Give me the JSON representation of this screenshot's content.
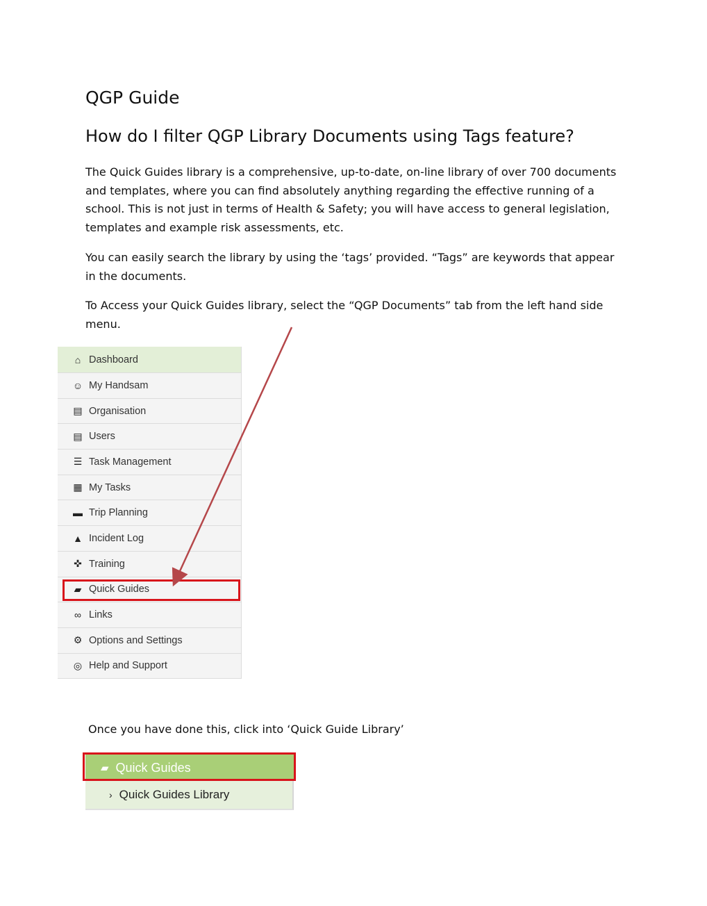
{
  "title": "QGP Guide",
  "heading": "How do I filter QGP Library Documents using Tags feature?",
  "paragraphs": {
    "p1": "The Quick Guides library is a comprehensive, up-to-date, on-line library of over 700 documents and templates, where you can find absolutely anything regarding the effective running of a school. This is not just in terms of Health & Safety; you will have access to general legislation, templates and example risk assessments, etc.",
    "p2": "You can easily search the library by using the ‘tags’ provided. “Tags” are keywords that appear in the documents.",
    "p3": "To Access your Quick Guides library, select the “QGP Documents” tab from  the left hand side menu.",
    "p4": "Once you have done this, click into ‘Quick Guide Library’"
  },
  "menu": {
    "items": [
      {
        "label": "Dashboard",
        "icon": "home-icon",
        "glyph": "⌂"
      },
      {
        "label": "My Handsam",
        "icon": "user-icon",
        "glyph": "☺"
      },
      {
        "label": "Organisation",
        "icon": "briefcase-icon",
        "glyph": "▤"
      },
      {
        "label": "Users",
        "icon": "briefcase-icon",
        "glyph": "▤"
      },
      {
        "label": "Task Management",
        "icon": "list-icon",
        "glyph": "☰"
      },
      {
        "label": "My Tasks",
        "icon": "table-icon",
        "glyph": "▦"
      },
      {
        "label": "Trip Planning",
        "icon": "car-icon",
        "glyph": "▬"
      },
      {
        "label": "Incident Log",
        "icon": "warning-icon",
        "glyph": "▲"
      },
      {
        "label": "Training",
        "icon": "move-icon",
        "glyph": "✜"
      },
      {
        "label": "Quick Guides",
        "icon": "book-icon",
        "glyph": "▰"
      },
      {
        "label": "Links",
        "icon": "link-icon",
        "glyph": "∞"
      },
      {
        "label": "Options and Settings",
        "icon": "gears-icon",
        "glyph": "⚙"
      },
      {
        "label": "Help and Support",
        "icon": "lifebuoy-icon",
        "glyph": "◎"
      }
    ]
  },
  "quick_guides_panel": {
    "header": "Quick Guides",
    "header_icon": "book-icon",
    "sub_item": "Quick Guides Library",
    "sub_icon": "chevron-right-icon"
  },
  "colors": {
    "highlight": "#d8141b",
    "arrow": "#b5474a",
    "active_menu": "#e3efd7",
    "panel_header": "#a9cf77"
  }
}
